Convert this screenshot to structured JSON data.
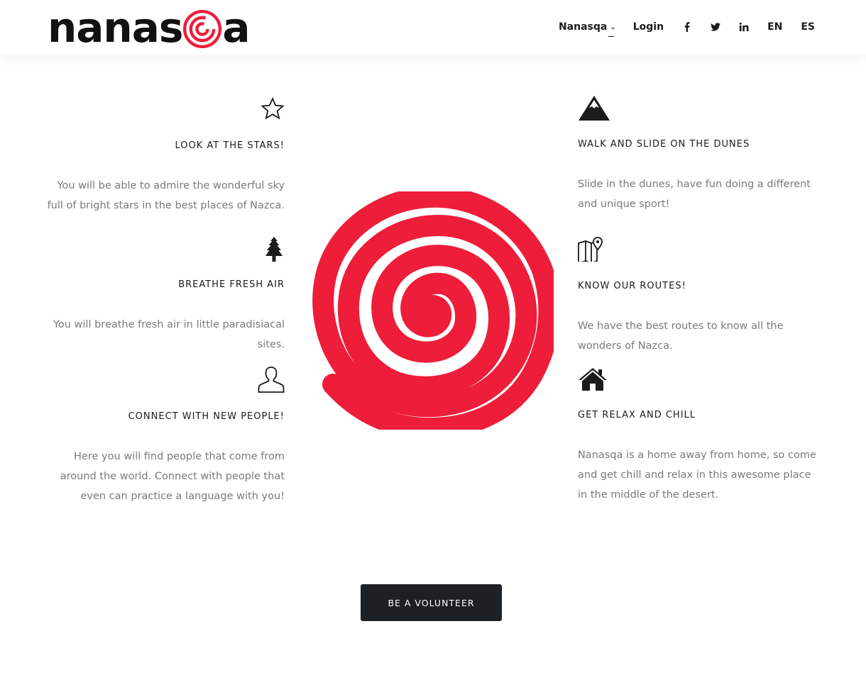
{
  "brand": {
    "logo_text_before": "nanas",
    "logo_text_after": "a",
    "accent_color": "#ee1d3a"
  },
  "nav": {
    "menu_label": "Nanasqa",
    "login_label": "Login",
    "social": [
      {
        "icon": "facebook-icon"
      },
      {
        "icon": "twitter-icon"
      },
      {
        "icon": "linkedin-icon"
      }
    ],
    "languages": [
      "EN",
      "ES"
    ]
  },
  "features_left": [
    {
      "icon": "star-icon",
      "title": "LOOK AT THE STARS!",
      "text": "You will be able to admire the wonderful sky full of bright stars in the best places of Nazca."
    },
    {
      "icon": "tree-icon",
      "title": "BREATHE FRESH AIR",
      "text": "You will breathe fresh air in little paradisiacal sites."
    },
    {
      "icon": "person-icon",
      "title": "CONNECT WITH NEW PEOPLE!",
      "text": "Here you will find people that come from around the world. Connect with people that even can practice a language with you!"
    }
  ],
  "features_right": [
    {
      "icon": "mountain-icon",
      "title": "WALK AND SLIDE ON THE DUNES",
      "text": "Slide in the dunes, have fun doing a different and unique sport!"
    },
    {
      "icon": "map-icon",
      "title": "KNOW OUR ROUTES!",
      "text": "We have the best routes to know all the wonders of Nazca."
    },
    {
      "icon": "house-icon",
      "title": "GET RELAX AND CHILL",
      "text": "Nanasqa is a home away from home, so come and get chill and relax in this awesome place in the middle of the desert."
    }
  ],
  "cta": {
    "label": "BE A VOLUNTEER"
  }
}
